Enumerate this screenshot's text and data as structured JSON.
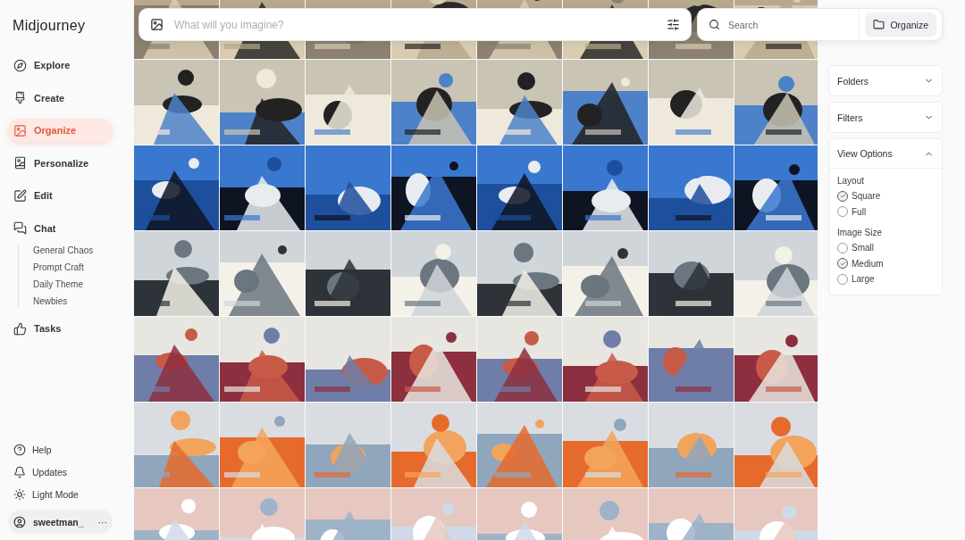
{
  "brand": "Midjourney",
  "nav": [
    {
      "label": "Explore",
      "selected": false
    },
    {
      "label": "Create",
      "selected": false
    },
    {
      "label": "Organize",
      "selected": true
    },
    {
      "label": "Personalize",
      "selected": false
    },
    {
      "label": "Edit",
      "selected": false
    },
    {
      "label": "Chat",
      "selected": false,
      "children": [
        {
          "label": "General Chaos"
        },
        {
          "label": "Prompt Craft"
        },
        {
          "label": "Daily Theme"
        },
        {
          "label": "Newbies"
        }
      ]
    },
    {
      "label": "Tasks",
      "selected": false
    }
  ],
  "footer": [
    {
      "label": "Help"
    },
    {
      "label": "Updates"
    },
    {
      "label": "Light Mode"
    }
  ],
  "user": {
    "name": "sweetman_",
    "more": "···"
  },
  "prompt": {
    "placeholder": "What will you imagine?"
  },
  "search": {
    "placeholder": "Search"
  },
  "organize_button": "Organize",
  "panels": [
    {
      "title": "Folders",
      "expanded": false
    },
    {
      "title": "Filters",
      "expanded": false
    },
    {
      "title": "View Options",
      "expanded": true,
      "groups": [
        {
          "label": "Layout",
          "options": [
            {
              "label": "Square",
              "selected": true
            },
            {
              "label": "Full",
              "selected": false
            }
          ]
        },
        {
          "label": "Image Size",
          "options": [
            {
              "label": "Small",
              "selected": false
            },
            {
              "label": "Medium",
              "selected": true
            },
            {
              "label": "Large",
              "selected": false
            }
          ]
        }
      ]
    }
  ]
}
